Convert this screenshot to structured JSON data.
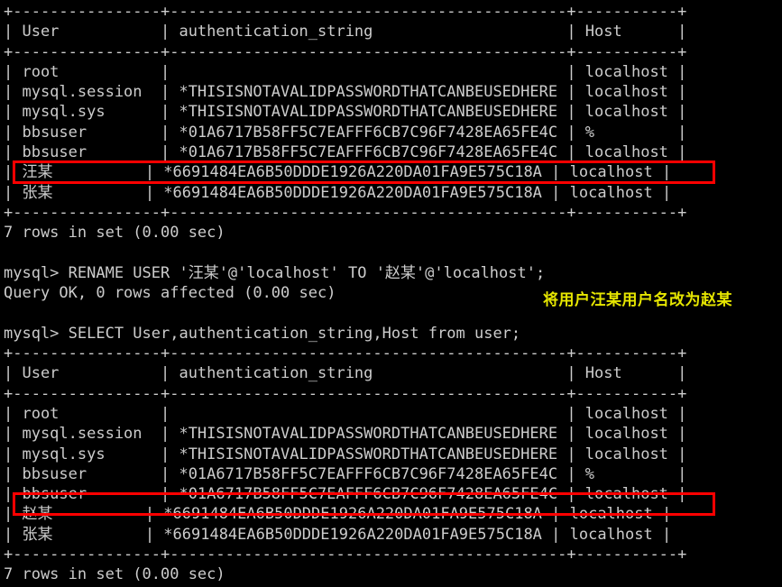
{
  "terminal": {
    "prompt": "mysql>",
    "colors": {
      "background": "#000000",
      "foreground": "#cccccc",
      "highlight_box": "#ff0000",
      "annotation": "#e6e600"
    },
    "lines": [
      "+----------------+-------------------------------------------+-----------+",
      "| User           | authentication_string                     | Host      |",
      "+----------------+-------------------------------------------+-----------+",
      "| root           |                                           | localhost |",
      "| mysql.session  | *THISISNOTAVALIDPASSWORDTHATCANBEUSEDHERE | localhost |",
      "| mysql.sys      | *THISISNOTAVALIDPASSWORDTHATCANBEUSEDHERE | localhost |",
      "| bbsuser        | *01A6717B58FF5C7EAFFF6CB7C96F7428EA65FE4C | %         |",
      "| bbsuser        | *01A6717B58FF5C7EAFFF6CB7C96F7428EA65FE4C | localhost |",
      "| 汪某          | *6691484EA6B50DDDE1926A220DA01FA9E575C18A | localhost |",
      "| 张某          | *6691484EA6B50DDDE1926A220DA01FA9E575C18A | localhost |",
      "+----------------+-------------------------------------------+-----------+",
      "7 rows in set (0.00 sec)",
      "",
      "mysql> RENAME USER '汪某'@'localhost' TO '赵某'@'localhost';",
      "Query OK, 0 rows affected (0.00 sec)",
      "",
      "mysql> SELECT User,authentication_string,Host from user;",
      "+----------------+-------------------------------------------+-----------+",
      "| User           | authentication_string                     | Host      |",
      "+----------------+-------------------------------------------+-----------+",
      "| root           |                                           | localhost |",
      "| mysql.session  | *THISISNOTAVALIDPASSWORDTHATCANBEUSEDHERE | localhost |",
      "| mysql.sys      | *THISISNOTAVALIDPASSWORDTHATCANBEUSEDHERE | localhost |",
      "| bbsuser        | *01A6717B58FF5C7EAFFF6CB7C96F7428EA65FE4C | %         |",
      "| bbsuser        | *01A6717B58FF5C7EAFFF6CB7C96F7428EA65FE4C | localhost |",
      "| 赵某          | *6691484EA6B50DDDE1926A220DA01FA9E575C18A | localhost |",
      "| 张某          | *6691484EA6B50DDDE1926A220DA01FA9E575C18A | localhost |",
      "+----------------+-------------------------------------------+-----------+",
      "7 rows in set (0.00 sec)"
    ],
    "table_columns": [
      "User",
      "authentication_string",
      "Host"
    ],
    "table_before": {
      "rows": [
        {
          "user": "root",
          "authentication_string": "",
          "host": "localhost"
        },
        {
          "user": "mysql.session",
          "authentication_string": "*THISISNOTAVALIDPASSWORDTHATCANBEUSEDHERE",
          "host": "localhost"
        },
        {
          "user": "mysql.sys",
          "authentication_string": "*THISISNOTAVALIDPASSWORDTHATCANBEUSEDHERE",
          "host": "localhost"
        },
        {
          "user": "bbsuser",
          "authentication_string": "*01A6717B58FF5C7EAFFF6CB7C96F7428EA65FE4C",
          "host": "%"
        },
        {
          "user": "bbsuser",
          "authentication_string": "*01A6717B58FF5C7EAFFF6CB7C96F7428EA65FE4C",
          "host": "localhost"
        },
        {
          "user": "汪某",
          "authentication_string": "*6691484EA6B50DDDE1926A220DA01FA9E575C18A",
          "host": "localhost"
        },
        {
          "user": "张某",
          "authentication_string": "*6691484EA6B50DDDE1926A220DA01FA9E575C18A",
          "host": "localhost"
        }
      ],
      "row_count_text": "7 rows in set (0.00 sec)"
    },
    "table_after": {
      "rows": [
        {
          "user": "root",
          "authentication_string": "",
          "host": "localhost"
        },
        {
          "user": "mysql.session",
          "authentication_string": "*THISISNOTAVALIDPASSWORDTHATCANBEUSEDHERE",
          "host": "localhost"
        },
        {
          "user": "mysql.sys",
          "authentication_string": "*THISISNOTAVALIDPASSWORDTHATCANBEUSEDHERE",
          "host": "localhost"
        },
        {
          "user": "bbsuser",
          "authentication_string": "*01A6717B58FF5C7EAFFF6CB7C96F7428EA65FE4C",
          "host": "%"
        },
        {
          "user": "bbsuser",
          "authentication_string": "*01A6717B58FF5C7EAFFF6CB7C96F7428EA65FE4C",
          "host": "localhost"
        },
        {
          "user": "赵某",
          "authentication_string": "*6691484EA6B50DDDE1926A220DA01FA9E575C18A",
          "host": "localhost"
        },
        {
          "user": "张某",
          "authentication_string": "*6691484EA6B50DDDE1926A220DA01FA9E575C18A",
          "host": "localhost"
        }
      ],
      "row_count_text": "7 rows in set (0.00 sec)"
    },
    "commands": [
      {
        "prompt": "mysql>",
        "sql": "RENAME USER '汪某'@'localhost' TO '赵某'@'localhost';"
      },
      {
        "prompt": "mysql>",
        "sql": "SELECT User,authentication_string,Host from user;"
      }
    ],
    "query_result_text": "Query OK, 0 rows affected (0.00 sec)",
    "annotation": "将用户汪某用户名改为赵某"
  }
}
